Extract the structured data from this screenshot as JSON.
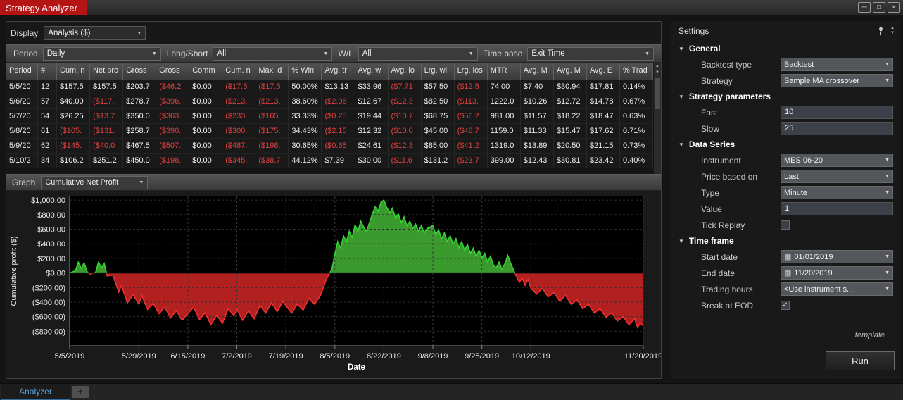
{
  "window": {
    "title": "Strategy Analyzer",
    "controls": {
      "minimize": "─",
      "maximize": "□",
      "close": "×"
    }
  },
  "display": {
    "label": "Display",
    "value": "Analysis ($)"
  },
  "filters": {
    "period": {
      "label": "Period",
      "value": "Daily"
    },
    "long_short": {
      "label": "Long/Short",
      "value": "All"
    },
    "win_loss": {
      "label": "W/L",
      "value": "All"
    },
    "time_base": {
      "label": "Time base",
      "value": "Exit Time"
    }
  },
  "table": {
    "columns": [
      "Period",
      "#",
      "Cum. n",
      "Net pro",
      "Gross",
      "Gross",
      "Comm",
      "Cum. n",
      "Max. d",
      "% Win",
      "Avg. tr",
      "Avg. w",
      "Avg. lo",
      "Lrg. wi",
      "Lrg. los",
      "MTR",
      "Avg. M",
      "Avg. M",
      "Avg. E",
      "% Trad"
    ],
    "rows": [
      [
        "5/5/20",
        "12",
        "$157.5",
        "$157.5",
        "$203.7",
        "($46.2",
        "$0.00",
        "($17.5",
        "($17.5",
        "50.00%",
        "$13.13",
        "$33.96",
        "($7.71",
        "$57.50",
        "($12.5",
        "74.00",
        "$7.40",
        "$30.94",
        "$17.81",
        "0.14%"
      ],
      [
        "5/6/20",
        "57",
        "$40.00",
        "($117.",
        "$278.7",
        "($396.",
        "$0.00",
        "($213.",
        "($213.",
        "38.60%",
        "($2.06",
        "$12.67",
        "($12.3",
        "$82.50",
        "($113.",
        "1222.0",
        "$10.26",
        "$12.72",
        "$14.78",
        "0.67%"
      ],
      [
        "5/7/20",
        "54",
        "$26.25",
        "($13.7",
        "$350.0",
        "($363.",
        "$0.00",
        "($233.",
        "($165.",
        "33.33%",
        "($0.25",
        "$19.44",
        "($10.7",
        "$68.75",
        "($56.2",
        "981.00",
        "$11.57",
        "$18.22",
        "$18.47",
        "0.63%"
      ],
      [
        "5/8/20",
        "61",
        "($105.",
        "($131.",
        "$258.7",
        "($390.",
        "$0.00",
        "($300.",
        "($175.",
        "34.43%",
        "($2.15",
        "$12.32",
        "($10.0",
        "$45.00",
        "($48.7",
        "1159.0",
        "$11.33",
        "$15.47",
        "$17.62",
        "0.71%"
      ],
      [
        "5/9/20",
        "62",
        "($145.",
        "($40.0",
        "$467.5",
        "($507.",
        "$0.00",
        "($487.",
        "($198.",
        "30.65%",
        "($0.65",
        "$24.61",
        "($12.3",
        "$85.00",
        "($41.2",
        "1319.0",
        "$13.89",
        "$20.50",
        "$21.15",
        "0.73%"
      ],
      [
        "5/10/2",
        "34",
        "$106.2",
        "$251.2",
        "$450.0",
        "($198.",
        "$0.00",
        "($345.",
        "($38.7",
        "44.12%",
        "$7.39",
        "$30.00",
        "($11.6",
        "$131.2",
        "($23.7",
        "399.00",
        "$12.43",
        "$30.81",
        "$23.42",
        "0.40%"
      ]
    ]
  },
  "graph": {
    "label": "Graph",
    "value": "Cumulative Net Profit"
  },
  "chart_data": {
    "type": "area",
    "series_name": "Cumulative Net Profit",
    "xlabel": "Date",
    "ylabel": "Cumulative profit ($)",
    "ylim": [
      -1000,
      1050
    ],
    "x_max_day": 199,
    "grid": true,
    "colors": {
      "positive_line": "#35d435",
      "positive_fill": "#3a9a2e",
      "negative_line": "#f03030",
      "negative_fill": "#b32020",
      "plot_bg": "#000000"
    },
    "y_ticks": [
      {
        "label": "$1,000.00",
        "value": 1000
      },
      {
        "label": "$800.00",
        "value": 800
      },
      {
        "label": "$600.00",
        "value": 600
      },
      {
        "label": "$400.00",
        "value": 400
      },
      {
        "label": "$200.00",
        "value": 200
      },
      {
        "label": "$0.00",
        "value": 0
      },
      {
        "label": "($200.00)",
        "value": -200
      },
      {
        "label": "($400.00)",
        "value": -400
      },
      {
        "label": "($600.00)",
        "value": -600
      },
      {
        "label": "($800.00)",
        "value": -800
      }
    ],
    "x_ticks": [
      {
        "label": "5/5/2019",
        "day": 0
      },
      {
        "label": "5/29/2019",
        "day": 24
      },
      {
        "label": "6/15/2019",
        "day": 41
      },
      {
        "label": "7/2/2019",
        "day": 58
      },
      {
        "label": "7/19/2019",
        "day": 75
      },
      {
        "label": "8/5/2019",
        "day": 92
      },
      {
        "label": "8/22/2019",
        "day": 109
      },
      {
        "label": "9/8/2019",
        "day": 126
      },
      {
        "label": "9/25/2019",
        "day": 143
      },
      {
        "label": "10/12/2019",
        "day": 160
      },
      {
        "label": "11/20/2019",
        "day": 199
      }
    ],
    "points": [
      [
        0,
        0
      ],
      [
        2,
        30
      ],
      [
        3,
        150
      ],
      [
        4,
        60
      ],
      [
        5,
        140
      ],
      [
        6,
        20
      ],
      [
        7,
        -20
      ],
      [
        9,
        10
      ],
      [
        10,
        150
      ],
      [
        11,
        70
      ],
      [
        12,
        130
      ],
      [
        13,
        -40
      ],
      [
        15,
        -30
      ],
      [
        17,
        -260
      ],
      [
        18,
        -170
      ],
      [
        20,
        -410
      ],
      [
        22,
        -300
      ],
      [
        24,
        -430
      ],
      [
        25,
        -310
      ],
      [
        27,
        -500
      ],
      [
        29,
        -420
      ],
      [
        31,
        -560
      ],
      [
        33,
        -470
      ],
      [
        35,
        -620
      ],
      [
        37,
        -520
      ],
      [
        39,
        -650
      ],
      [
        41,
        -560
      ],
      [
        43,
        -470
      ],
      [
        45,
        -640
      ],
      [
        47,
        -550
      ],
      [
        49,
        -710
      ],
      [
        51,
        -580
      ],
      [
        53,
        -690
      ],
      [
        55,
        -490
      ],
      [
        57,
        -590
      ],
      [
        58,
        -500
      ],
      [
        60,
        -650
      ],
      [
        62,
        -520
      ],
      [
        64,
        -630
      ],
      [
        66,
        -450
      ],
      [
        68,
        -550
      ],
      [
        70,
        -410
      ],
      [
        72,
        -530
      ],
      [
        74,
        -390
      ],
      [
        75,
        -450
      ],
      [
        77,
        -550
      ],
      [
        79,
        -430
      ],
      [
        81,
        -510
      ],
      [
        83,
        -350
      ],
      [
        85,
        -430
      ],
      [
        87,
        -310
      ],
      [
        88,
        -200
      ],
      [
        89,
        -90
      ],
      [
        90,
        -20
      ],
      [
        91,
        60
      ],
      [
        92,
        260
      ],
      [
        93,
        430
      ],
      [
        94,
        340
      ],
      [
        95,
        510
      ],
      [
        96,
        430
      ],
      [
        97,
        570
      ],
      [
        98,
        490
      ],
      [
        99,
        660
      ],
      [
        100,
        570
      ],
      [
        101,
        710
      ],
      [
        102,
        630
      ],
      [
        103,
        570
      ],
      [
        104,
        690
      ],
      [
        105,
        810
      ],
      [
        106,
        910
      ],
      [
        107,
        850
      ],
      [
        108,
        970
      ],
      [
        109,
        1000
      ],
      [
        110,
        900
      ],
      [
        111,
        830
      ],
      [
        112,
        890
      ],
      [
        113,
        750
      ],
      [
        114,
        810
      ],
      [
        115,
        690
      ],
      [
        116,
        770
      ],
      [
        117,
        650
      ],
      [
        118,
        710
      ],
      [
        119,
        610
      ],
      [
        120,
        670
      ],
      [
        121,
        570
      ],
      [
        122,
        650
      ],
      [
        123,
        550
      ],
      [
        124,
        610
      ],
      [
        126,
        650
      ],
      [
        127,
        530
      ],
      [
        128,
        590
      ],
      [
        129,
        470
      ],
      [
        130,
        550
      ],
      [
        131,
        430
      ],
      [
        132,
        510
      ],
      [
        133,
        390
      ],
      [
        134,
        470
      ],
      [
        135,
        350
      ],
      [
        136,
        430
      ],
      [
        137,
        310
      ],
      [
        138,
        390
      ],
      [
        139,
        270
      ],
      [
        140,
        340
      ],
      [
        141,
        230
      ],
      [
        142,
        310
      ],
      [
        143,
        210
      ],
      [
        144,
        270
      ],
      [
        145,
        150
      ],
      [
        146,
        230
      ],
      [
        147,
        110
      ],
      [
        148,
        70
      ],
      [
        149,
        150
      ],
      [
        150,
        50
      ],
      [
        151,
        130
      ],
      [
        152,
        240
      ],
      [
        153,
        130
      ],
      [
        154,
        40
      ],
      [
        155,
        -50
      ],
      [
        156,
        -130
      ],
      [
        157,
        -70
      ],
      [
        158,
        -170
      ],
      [
        159,
        -90
      ],
      [
        160,
        -210
      ],
      [
        162,
        -290
      ],
      [
        164,
        -210
      ],
      [
        166,
        -330
      ],
      [
        168,
        -270
      ],
      [
        170,
        -390
      ],
      [
        172,
        -310
      ],
      [
        174,
        -430
      ],
      [
        176,
        -370
      ],
      [
        178,
        -490
      ],
      [
        180,
        -430
      ],
      [
        182,
        -550
      ],
      [
        184,
        -490
      ],
      [
        186,
        -610
      ],
      [
        188,
        -550
      ],
      [
        190,
        -660
      ],
      [
        192,
        -600
      ],
      [
        194,
        -710
      ],
      [
        196,
        -630
      ],
      [
        197,
        -750
      ],
      [
        198,
        -690
      ],
      [
        199,
        -730
      ]
    ]
  },
  "settings": {
    "title": "Settings",
    "sections": [
      {
        "label": "General",
        "rows": [
          {
            "label": "Backtest type",
            "control": "select",
            "value": "Backtest"
          },
          {
            "label": "Strategy",
            "control": "select",
            "value": "Sample MA crossover"
          }
        ]
      },
      {
        "label": "Strategy parameters",
        "rows": [
          {
            "label": "Fast",
            "control": "input",
            "value": "10"
          },
          {
            "label": "Slow",
            "control": "input",
            "value": "25"
          }
        ]
      },
      {
        "label": "Data Series",
        "rows": [
          {
            "label": "Instrument",
            "control": "select",
            "value": "MES 06-20"
          },
          {
            "label": "Price based on",
            "control": "select",
            "value": "Last"
          },
          {
            "label": "Type",
            "control": "select",
            "value": "Minute"
          },
          {
            "label": "Value",
            "control": "input",
            "value": "1"
          },
          {
            "label": "Tick Replay",
            "control": "checkbox",
            "checked": false
          }
        ]
      },
      {
        "label": "Time frame",
        "rows": [
          {
            "label": "Start date",
            "control": "date",
            "value": "01/01/2019"
          },
          {
            "label": "End date",
            "control": "date",
            "value": "11/20/2019"
          },
          {
            "label": "Trading hours",
            "control": "select",
            "value": "<Use instrument s..."
          },
          {
            "label": "Break at EOD",
            "control": "checkbox",
            "checked": true
          }
        ]
      }
    ],
    "template_link": "template",
    "run_button": "Run"
  },
  "tabs": {
    "items": [
      {
        "label": "Analyzer"
      }
    ],
    "add_label": "+"
  }
}
